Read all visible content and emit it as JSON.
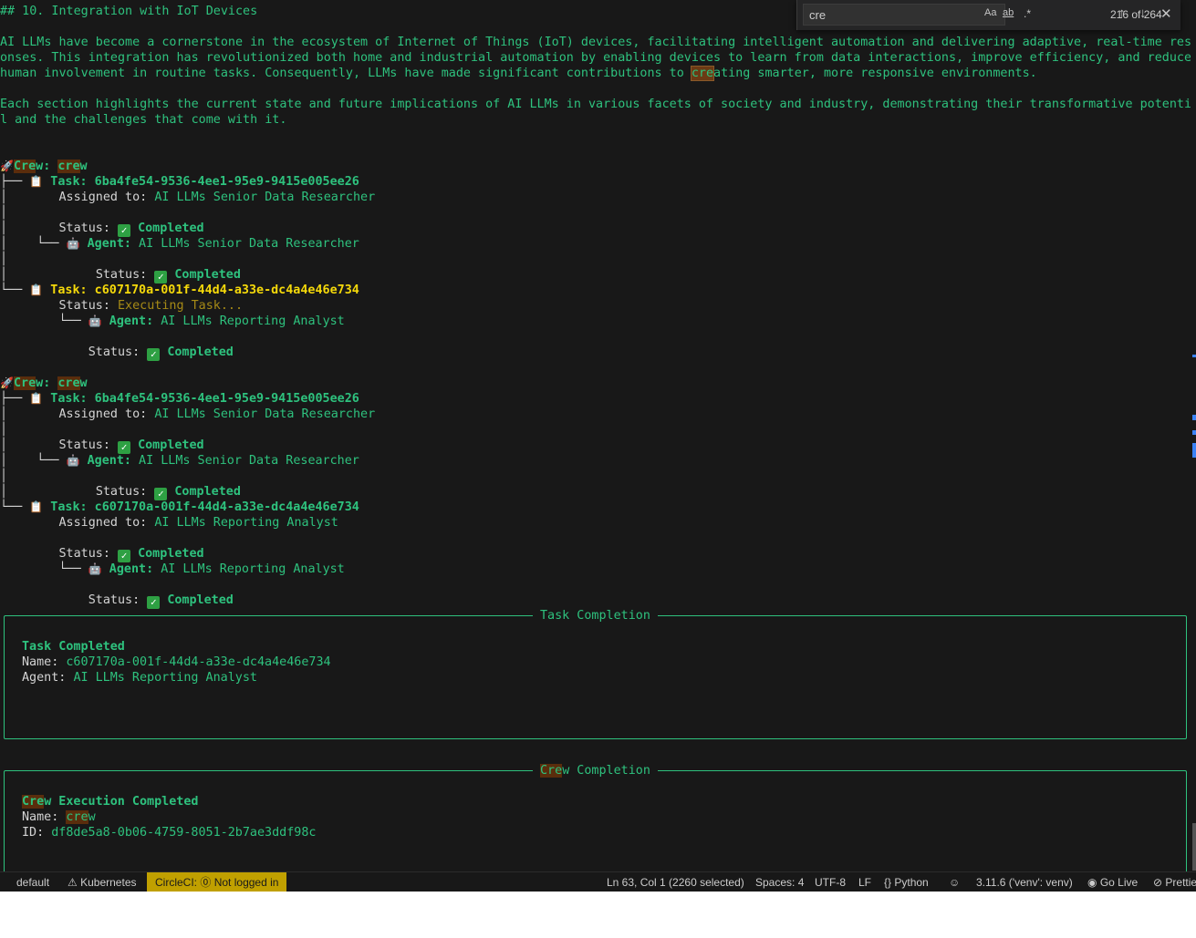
{
  "terminal": {
    "heading": "## 10. Integration with IoT Devices",
    "para1": [
      "AI LLMs have become a cornerstone in the ecosystem of Internet of Things (IoT) devices, facilitating intelligent automation and delivering adaptive, real-time resp",
      "onses. This integration has revolutionized both home and industrial automation by enabling devices to learn from data interactions, improve efficiency, and reduce",
      "human involvement in routine tasks. Consequently, LLMs have made significant contributions to "
    ],
    "para1_match": "cre",
    "para1_tail": "ating smarter, more responsive environments.",
    "para2": [
      "Each section highlights the current state and future implications of AI LLMs in various facets of society and industry, demonstrating their transformative potentia",
      "l and the challenges that come with it."
    ],
    "labels": {
      "crew_prefix": "Cre",
      "crew_suffix": "w:",
      "crew_name_hl": "cre",
      "crew_name_rest": "w",
      "task": "Task:",
      "assigned": "Assigned to:",
      "status": "Status:",
      "agent": "Agent:",
      "completed": "Completed",
      "executing": "Executing Task..."
    },
    "ids": {
      "task1": "6ba4fe54-9536-4ee1-95e9-9415e005ee26",
      "task2": "c607170a-001f-44d4-a33e-dc4a4e46e734"
    },
    "agents": {
      "researcher": "AI LLMs Senior Data Researcher",
      "analyst": "AI LLMs Reporting Analyst"
    },
    "panel1": {
      "title": "Task Completion",
      "heading": "Task Completed",
      "name_label": "Name:",
      "name_value": "c607170a-001f-44d4-a33e-dc4a4e46e734",
      "agent_label": "Agent:",
      "agent_value": "AI LLMs Reporting Analyst"
    },
    "panel2": {
      "title_hl": "Cre",
      "title_rest": "w Completion",
      "heading_hl": "Cre",
      "heading_rest": "w Execution Completed",
      "name_label": "Name:",
      "name_hl": "cre",
      "name_rest": "w",
      "id_label": "ID:",
      "id_value": "df8de5a8-0b06-4759-8051-2b7ae3ddf98c"
    }
  },
  "find": {
    "query": "cre",
    "match_case": "Aa",
    "whole_word": "ab",
    "regex": ".*",
    "count": "216 of 264",
    "prev_icon": "arrow-up-icon",
    "next_icon": "arrow-down-icon",
    "close_icon": "close-icon"
  },
  "statusbar": {
    "default": "default",
    "kubernetes": "Kubernetes",
    "circleci_label": "CircleCI:",
    "circleci_status": "Not logged in",
    "position": "Ln 63, Col 1 (2260 selected)",
    "spaces": "Spaces: 4",
    "encoding": "UTF-8",
    "eol": "LF",
    "language": "Python",
    "interpreter": "3.11.6 ('venv': venv)",
    "golive": "Go Live",
    "prettier": "Prettier"
  },
  "colors": {
    "background": "#181818",
    "green": "#2ec27e",
    "yellow": "#f5d90a",
    "match_highlight": "#5a2d0c",
    "circleci_bg": "#c0a000"
  }
}
